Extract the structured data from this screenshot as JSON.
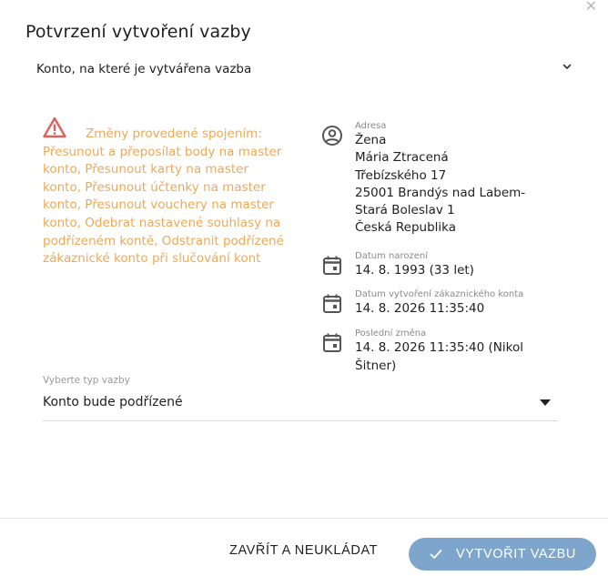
{
  "dialog": {
    "title": "Potvrzení vytvoření vazby",
    "close_icon": "close-icon"
  },
  "account_select": {
    "label": "Konto, na které je vytvářena vazba",
    "icon": "chevron-down-icon"
  },
  "warning": {
    "icon": "warning-triangle-icon",
    "text": "Změny provedené spojením: Přesunout a přeposílat body na master konto, Přesunout karty na master konto, Přesunout účtenky na master konto, Přesunout vouchery na master konto, Odebrat nastavené souhlasy na podřízeném kontě, Odstranit podřízené zákaznické konto při slučování kont",
    "color": "#f0a857"
  },
  "info": {
    "address": {
      "icon": "account-circle-icon",
      "label": "Adresa",
      "lines": [
        "Žena",
        "Mária Ztracená",
        "Třebízského 17",
        "25001 Brandýs nad Labem-",
        "Stará Boleslav 1",
        "Česká Republika"
      ]
    },
    "birth": {
      "icon": "calendar-icon",
      "label": "Datum narození",
      "value": "14. 8. 1993 (33 let)"
    },
    "created": {
      "icon": "calendar-icon",
      "label": "Datum vytvoření zákaznického konta",
      "value": "14. 8. 2026 11:35:40"
    },
    "changed": {
      "icon": "calendar-icon",
      "label": "Poslední změna",
      "value": "14. 8. 2026 11:35:40 (Nikol Šitner)"
    }
  },
  "relation_type": {
    "label": "Vyberte typ vazby",
    "value": "Konto bude podřízené",
    "icon": "caret-down-icon"
  },
  "footer": {
    "close_label": "ZAVŘÍT A NEUKLÁDAT",
    "create_label": "VYTVOŘIT VAZBU",
    "create_icon": "check-icon",
    "create_color": "#7ea6cd"
  }
}
